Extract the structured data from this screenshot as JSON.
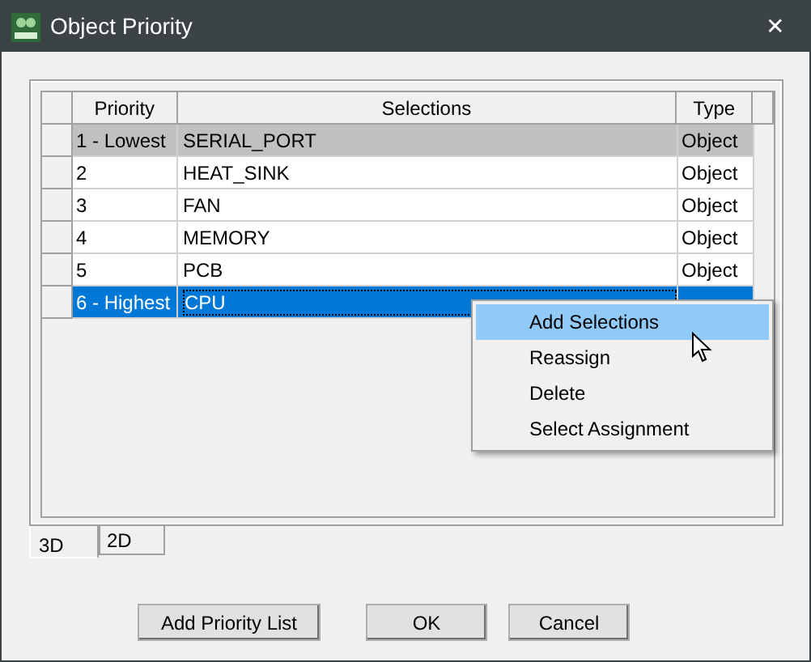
{
  "window": {
    "title": "Object Priority",
    "close": "✕"
  },
  "table": {
    "columns": [
      "Priority",
      "Selections",
      "Type"
    ],
    "rows": [
      {
        "priority": "1 - Lowest",
        "selection": "SERIAL_PORT",
        "type": "Object",
        "selected": false,
        "shaded": true
      },
      {
        "priority": "2",
        "selection": "HEAT_SINK",
        "type": "Object",
        "selected": false,
        "shaded": false
      },
      {
        "priority": "3",
        "selection": "FAN",
        "type": "Object",
        "selected": false,
        "shaded": false
      },
      {
        "priority": "4",
        "selection": "MEMORY",
        "type": "Object",
        "selected": false,
        "shaded": false
      },
      {
        "priority": "5",
        "selection": "PCB",
        "type": "Object",
        "selected": false,
        "shaded": false
      },
      {
        "priority": "6 - Highest",
        "selection": "CPU",
        "selected": true,
        "shaded": false
      }
    ]
  },
  "context_menu": {
    "items": [
      {
        "label": "Add Selections",
        "selected": true
      },
      {
        "label": "Reassign",
        "selected": false
      },
      {
        "label": "Delete",
        "selected": false
      },
      {
        "label": "Select Assignment",
        "selected": false
      }
    ]
  },
  "tabs": [
    {
      "label": "3D",
      "selected": true
    },
    {
      "label": "2D",
      "selected": false
    }
  ],
  "buttons": [
    "Add Priority List",
    "OK",
    "Cancel"
  ]
}
